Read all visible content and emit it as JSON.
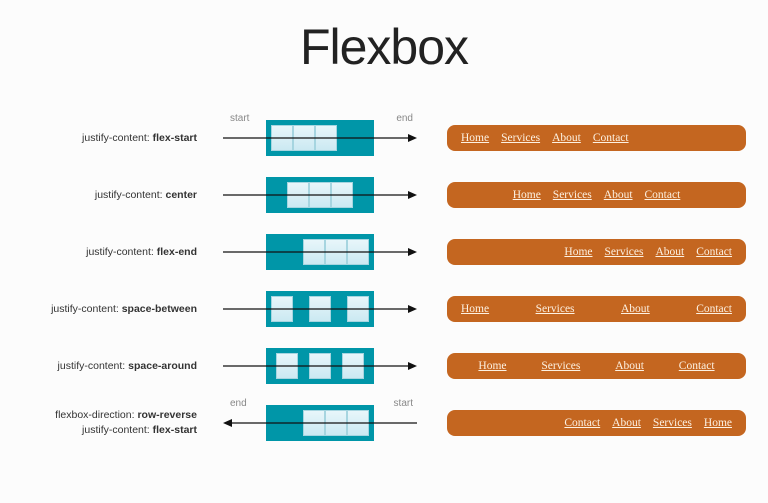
{
  "title": "Flexbox",
  "arrow_start": "start",
  "arrow_end": "end",
  "nav_items": [
    "Home",
    "Services",
    "About",
    "Contact"
  ],
  "colors": {
    "navbar_bg": "#c46620",
    "diagram_bg": "#0096a8",
    "item_border": "#a6d5e0"
  },
  "examples": [
    {
      "labels": [
        {
          "prop": "justify-content:",
          "val": "flex-start"
        }
      ],
      "justify": "flex-start",
      "direction": "row",
      "show_arrow_labels": true
    },
    {
      "labels": [
        {
          "prop": "justify-content:",
          "val": "center"
        }
      ],
      "justify": "center",
      "direction": "row",
      "show_arrow_labels": false
    },
    {
      "labels": [
        {
          "prop": "justify-content:",
          "val": "flex-end"
        }
      ],
      "justify": "flex-end",
      "direction": "row",
      "show_arrow_labels": false
    },
    {
      "labels": [
        {
          "prop": "justify-content:",
          "val": "space-between"
        }
      ],
      "justify": "space-between",
      "direction": "row",
      "show_arrow_labels": false
    },
    {
      "labels": [
        {
          "prop": "justify-content:",
          "val": "space-around"
        }
      ],
      "justify": "space-around",
      "direction": "row",
      "show_arrow_labels": false
    },
    {
      "labels": [
        {
          "prop": "flexbox-direction:",
          "val": "row-reverse"
        },
        {
          "prop": "justify-content:",
          "val": "flex-start"
        }
      ],
      "justify": "flex-start",
      "direction": "row-reverse",
      "show_arrow_labels": true
    }
  ]
}
